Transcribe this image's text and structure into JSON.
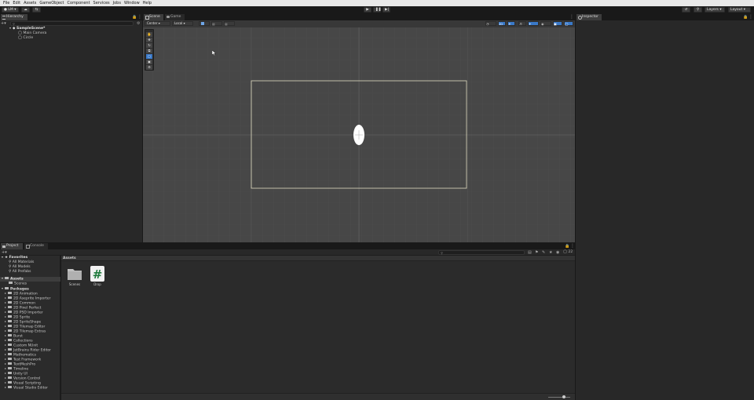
{
  "menubar": {
    "items": [
      "File",
      "Edit",
      "Assets",
      "GameObject",
      "Component",
      "Services",
      "Jobs",
      "Window",
      "Help"
    ]
  },
  "toolbar": {
    "account_label": "LM",
    "layers_label": "Layers",
    "layout_label": "Layout"
  },
  "hierarchy": {
    "tab_label": "Hierarchy",
    "scene_name": "SampleScene*",
    "items": [
      "Main Camera",
      "Circle"
    ]
  },
  "scene_view": {
    "tabs": [
      "Scene",
      "Game"
    ],
    "pivot_label": "Center",
    "space_label": "Local",
    "twod_label": "2D"
  },
  "inspector": {
    "tab_label": "Inspector"
  },
  "project": {
    "tabs": [
      "Project",
      "Console"
    ],
    "favorites_label": "Favorites",
    "favorites": [
      "All Materials",
      "All Models",
      "All Prefabs"
    ],
    "assets_label": "Assets",
    "assets_children": [
      "Scenes"
    ],
    "packages_label": "Packages",
    "packages": [
      "2D Animation",
      "2D Aseprite Importer",
      "2D Common",
      "2D Pixel Perfect",
      "2D PSD Importer",
      "2D Sprite",
      "2D SpriteShape",
      "2D Tilemap Editor",
      "2D Tilemap Extras",
      "Burst",
      "Collections",
      "Custom NUnit",
      "JetBrains Rider Editor",
      "Mathematics",
      "Test Framework",
      "TextMeshPro",
      "Timeline",
      "Unity UI",
      "Version Control",
      "Visual Scripting",
      "Visual Studio Editor"
    ],
    "breadcrumb": "Assets",
    "asset_items": [
      {
        "name": "Scenes",
        "icon": "folder-icon"
      },
      {
        "name": "Drop",
        "icon": "csharp-script-icon"
      }
    ],
    "count_label": "22"
  },
  "colors": {
    "menubar_bg": "#e8e8e8",
    "panel_bg": "#282828",
    "scene_bg": "#474747",
    "camera_frame": "#e0dcc0",
    "accent_blue": "#3a79c8",
    "script_green": "#1e7a3c"
  }
}
